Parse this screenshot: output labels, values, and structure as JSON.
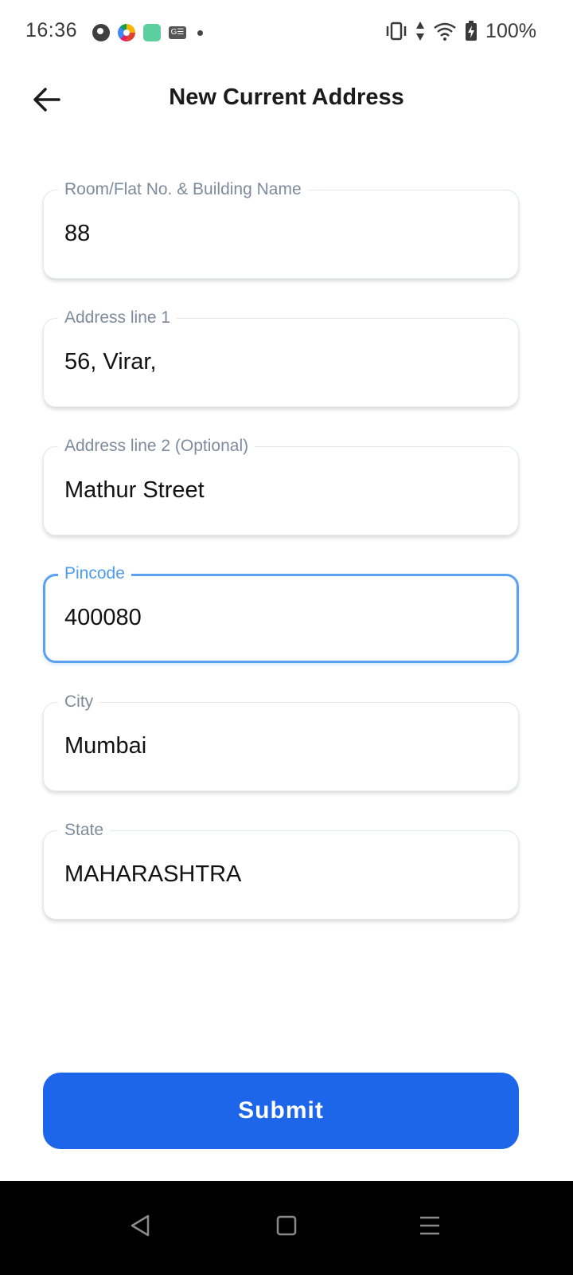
{
  "status_bar": {
    "time": "16:36",
    "battery_text": "100%",
    "notification_icons": [
      "p-circle-icon",
      "color-wheel-icon",
      "green-app-icon",
      "ge-app-icon",
      "dot-icon"
    ],
    "system_icons": [
      "vibrate-icon",
      "data-arrows-icon",
      "wifi-icon",
      "battery-charging-icon"
    ]
  },
  "header": {
    "title": "New Current Address",
    "back_icon": "arrow-left-icon"
  },
  "form": {
    "fields": [
      {
        "label": "Room/Flat No. & Building Name",
        "value": "88",
        "focused": false
      },
      {
        "label": "Address line 1",
        "value": "56, Virar,",
        "focused": false
      },
      {
        "label": "Address line 2 (Optional)",
        "value": "Mathur Street",
        "focused": false
      },
      {
        "label": "Pincode",
        "value": "400080",
        "focused": true
      },
      {
        "label": "City",
        "value": "Mumbai",
        "focused": false
      },
      {
        "label": "State",
        "value": "MAHARASHTRA",
        "focused": false
      }
    ],
    "submit_label": "Submit"
  },
  "colors": {
    "primary": "#1d66ea",
    "focus_border": "#5aa2ef",
    "label": "#7d8b9c"
  },
  "nav_bar": {
    "icons": [
      "back-triangle-icon",
      "home-square-icon",
      "menu-lines-icon"
    ]
  }
}
